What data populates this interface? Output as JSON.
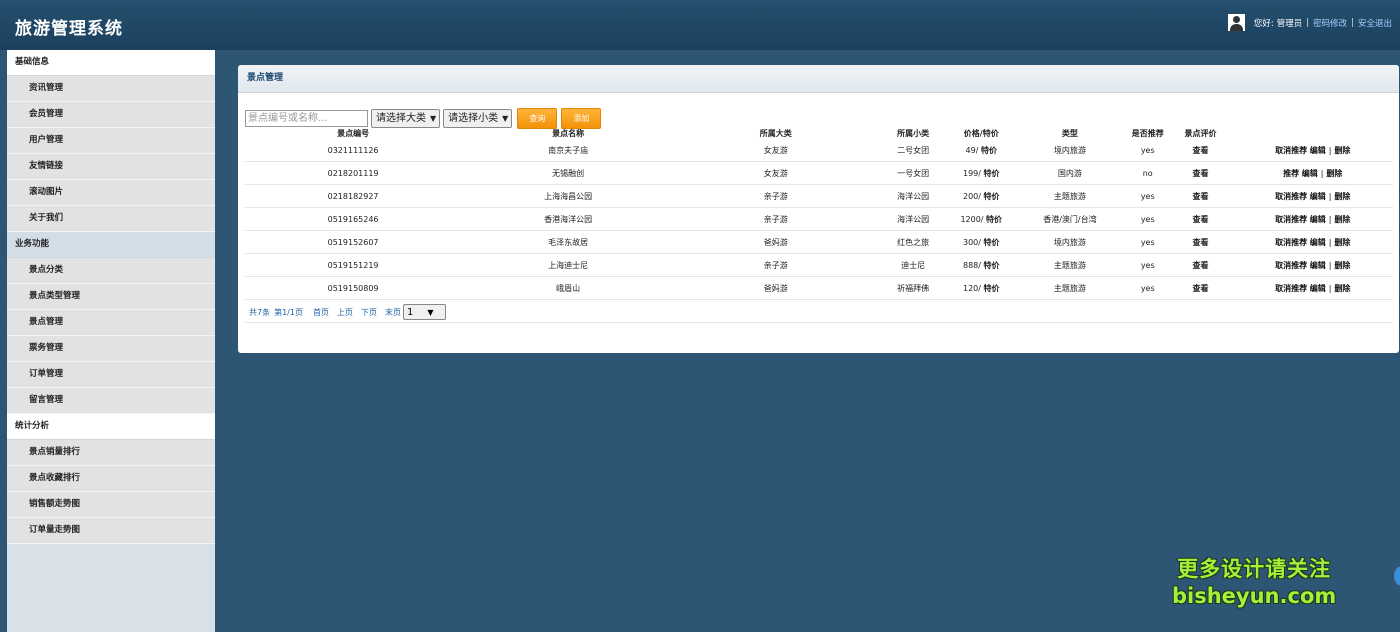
{
  "header": {
    "title": "旅游管理系统",
    "greeting": "您好:",
    "user": "管理员",
    "sep1": "|",
    "change_password": "密码修改",
    "sep2": "|",
    "logout": "安全退出"
  },
  "sidebar": {
    "sections": [
      {
        "title": "基础信息",
        "items": [
          "资讯管理",
          "会员管理",
          "用户管理",
          "友情链接",
          "滚动图片",
          "关于我们"
        ]
      },
      {
        "title": "业务功能",
        "items": [
          "景点分类",
          "景点类型管理",
          "景点管理",
          "票务管理",
          "订单管理",
          "留言管理"
        ]
      },
      {
        "title": "统计分析",
        "items": [
          "景点销量排行",
          "景点收藏排行",
          "销售额走势图",
          "订单量走势图"
        ]
      }
    ]
  },
  "panel": {
    "title": "景点管理",
    "search_placeholder": "景点编号或名称...",
    "category_select": "请选择大类",
    "subcategory_select": "请选择小类",
    "query_button": "查询",
    "add_button": "添加"
  },
  "table": {
    "headers": [
      "景点编号",
      "景点名称",
      "所属大类",
      "所属小类",
      "价格/特价",
      "类型",
      "是否推荐",
      "景点评价",
      ""
    ],
    "rows": [
      {
        "id": "0321111126",
        "name": "南京夫子庙",
        "cat": "女友游",
        "sub": "二号女团",
        "price": "49/",
        "special": "特价",
        "type": "境内旅游",
        "rec": "yes",
        "review": "查看",
        "toggle": "取消推荐",
        "edit": "编辑",
        "sep": "|",
        "del": "删除"
      },
      {
        "id": "0218201119",
        "name": "无锡融创",
        "cat": "女友游",
        "sub": "一号女团",
        "price": "199/",
        "special": "特价",
        "type": "国内游",
        "rec": "no",
        "review": "查看",
        "toggle": "推荐",
        "edit": "编辑",
        "sep": "|",
        "del": "删除"
      },
      {
        "id": "0218182927",
        "name": "上海海昌公园",
        "cat": "亲子游",
        "sub": "海洋公园",
        "price": "200/",
        "special": "特价",
        "type": "主题旅游",
        "rec": "yes",
        "review": "查看",
        "toggle": "取消推荐",
        "edit": "编辑",
        "sep": "|",
        "del": "删除"
      },
      {
        "id": "0519165246",
        "name": "香港海洋公园",
        "cat": "亲子游",
        "sub": "海洋公园",
        "price": "1200/",
        "special": "特价",
        "type": "香港/澳门/台湾",
        "rec": "yes",
        "review": "查看",
        "toggle": "取消推荐",
        "edit": "编辑",
        "sep": "|",
        "del": "删除"
      },
      {
        "id": "0519152607",
        "name": "毛泽东故居",
        "cat": "爸妈游",
        "sub": "红色之旅",
        "price": "300/",
        "special": "特价",
        "type": "境内旅游",
        "rec": "yes",
        "review": "查看",
        "toggle": "取消推荐",
        "edit": "编辑",
        "sep": "|",
        "del": "删除"
      },
      {
        "id": "0519151219",
        "name": "上海迪士尼",
        "cat": "亲子游",
        "sub": "迪士尼",
        "price": "888/",
        "special": "特价",
        "type": "主题旅游",
        "rec": "yes",
        "review": "查看",
        "toggle": "取消推荐",
        "edit": "编辑",
        "sep": "|",
        "del": "删除"
      },
      {
        "id": "0519150809",
        "name": "峨眉山",
        "cat": "爸妈游",
        "sub": "祈福拜佛",
        "price": "120/",
        "special": "特价",
        "type": "主题旅游",
        "rec": "yes",
        "review": "查看",
        "toggle": "取消推荐",
        "edit": "编辑",
        "sep": "|",
        "del": "删除"
      }
    ]
  },
  "pager": {
    "total": "共7条",
    "page": "第1/1页",
    "first": "首页",
    "prev": "上页",
    "next": "下页",
    "last": "末页",
    "current": "1"
  },
  "watermark": {
    "line1": "更多设计请关注",
    "line2": "bisheyun.com"
  }
}
